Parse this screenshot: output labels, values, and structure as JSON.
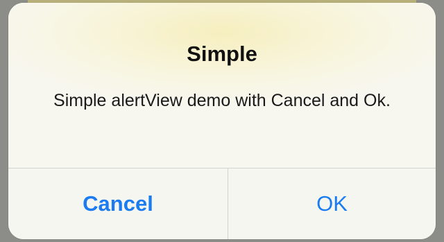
{
  "alert": {
    "title": "Simple",
    "message": "Simple alertView demo with Cancel and Ok.",
    "buttons": {
      "cancel_label": "Cancel",
      "ok_label": "OK"
    },
    "colors": {
      "button_text": "#1a7cf0",
      "title_text": "#111111",
      "background": "#f8f7ef"
    }
  }
}
